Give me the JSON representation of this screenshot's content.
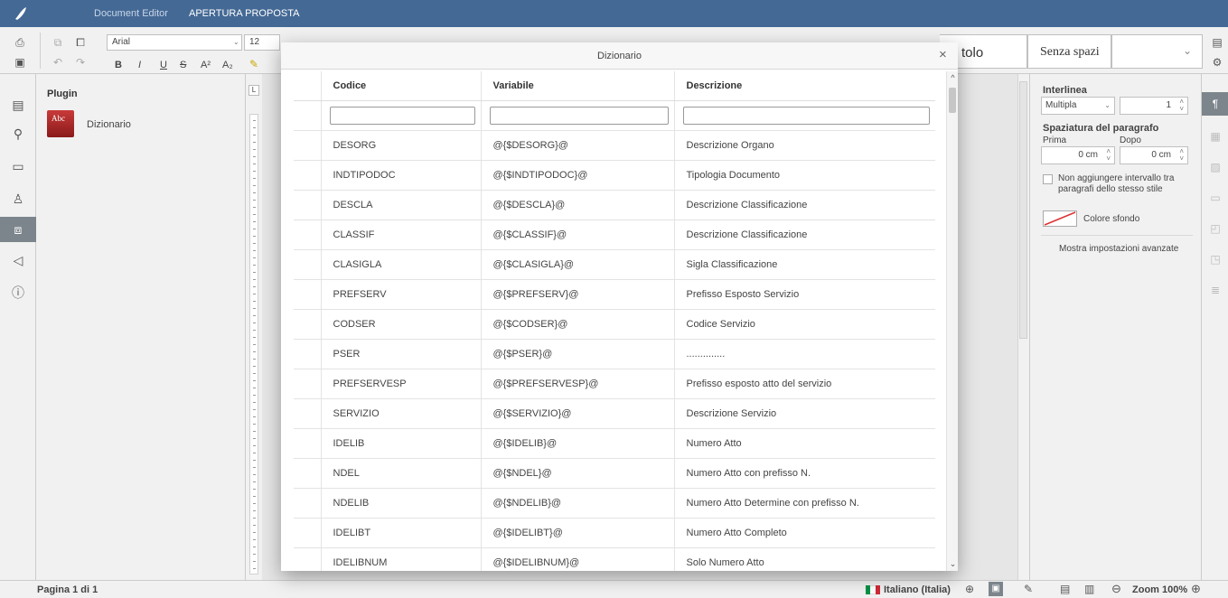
{
  "titlebar": {
    "app_label": "Document Editor",
    "doc_title": "APERTURA PROPOSTA"
  },
  "toolbar": {
    "font_name": "Arial",
    "font_size": "12",
    "bold": "B",
    "italic": "I",
    "underline": "U",
    "strike": "S",
    "superscript": "A²",
    "subscript": "A₂",
    "style_title_partial": "tolo",
    "style_no_spacing": "Senza spazi"
  },
  "plugin_panel": {
    "header": "Plugin",
    "item_label": "Dizionario",
    "item_icon_text": "Abc"
  },
  "modal": {
    "title": "Dizionario",
    "columns": [
      "Codice",
      "Variabile",
      "Descrizione"
    ],
    "rows": [
      {
        "codice": "DESORG",
        "variabile": "@{$DESORG}@",
        "descrizione": "Descrizione Organo"
      },
      {
        "codice": "INDTIPODOC",
        "variabile": "@{$INDTIPODOC}@",
        "descrizione": "Tipologia Documento"
      },
      {
        "codice": "DESCLA",
        "variabile": "@{$DESCLA}@",
        "descrizione": "Descrizione Classificazione"
      },
      {
        "codice": "CLASSIF",
        "variabile": "@{$CLASSIF}@",
        "descrizione": "Descrizione Classificazione"
      },
      {
        "codice": "CLASIGLA",
        "variabile": "@{$CLASIGLA}@",
        "descrizione": "Sigla Classificazione"
      },
      {
        "codice": "PREFSERV",
        "variabile": "@{$PREFSERV}@",
        "descrizione": "Prefisso Esposto Servizio"
      },
      {
        "codice": "CODSER",
        "variabile": "@{$CODSER}@",
        "descrizione": "Codice Servizio"
      },
      {
        "codice": "PSER",
        "variabile": "@{$PSER}@",
        "descrizione": ".............."
      },
      {
        "codice": "PREFSERVESP",
        "variabile": "@{$PREFSERVESP}@",
        "descrizione": "Prefisso esposto atto del servizio"
      },
      {
        "codice": "SERVIZIO",
        "variabile": "@{$SERVIZIO}@",
        "descrizione": "Descrizione Servizio"
      },
      {
        "codice": "IDELIB",
        "variabile": "@{$IDELIB}@",
        "descrizione": "Numero Atto"
      },
      {
        "codice": "NDEL",
        "variabile": "@{$NDEL}@",
        "descrizione": "Numero Atto con prefisso N."
      },
      {
        "codice": "NDELIB",
        "variabile": "@{$NDELIB}@",
        "descrizione": "Numero Atto Determine con prefisso N."
      },
      {
        "codice": "IDELIBT",
        "variabile": "@{$IDELIBT}@",
        "descrizione": "Numero Atto Completo"
      },
      {
        "codice": "IDELIBNUM",
        "variabile": "@{$IDELIBNUM}@",
        "descrizione": "Solo Numero Atto"
      }
    ]
  },
  "right_panel": {
    "line_spacing_label": "Interlinea",
    "line_spacing_mode": "Multipla",
    "line_spacing_value": "1",
    "paragraph_spacing_label": "Spaziatura del paragrafo",
    "before_label": "Prima",
    "after_label": "Dopo",
    "before_value": "0 cm",
    "after_value": "0 cm",
    "no_interval_label_1": "Non aggiungere intervallo tra",
    "no_interval_label_2": "paragrafi dello stesso stile",
    "background_color_label": "Colore sfondo",
    "advanced_label": "Mostra impostazioni avanzate"
  },
  "statusbar": {
    "page_info": "Pagina 1 di 1",
    "language": "Italiano (Italia)",
    "zoom": "Zoom 100%"
  },
  "colors": {
    "titlebar": "#446995",
    "active_tab": "#7d858c",
    "language_flag": [
      "#009246",
      "#ffffff",
      "#ce2b37"
    ]
  }
}
